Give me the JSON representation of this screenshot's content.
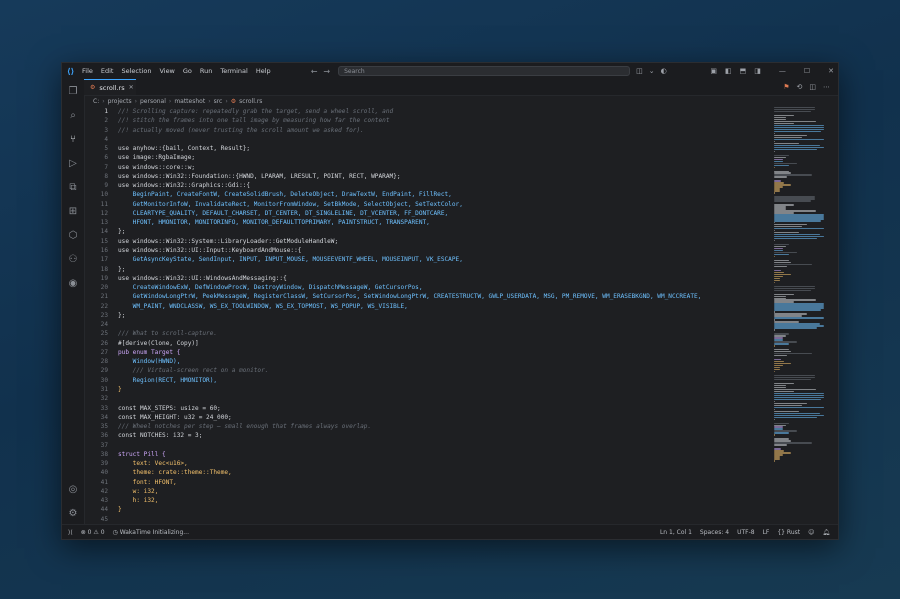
{
  "menu": [
    "File",
    "Edit",
    "Selection",
    "View",
    "Go",
    "Run",
    "Terminal",
    "Help"
  ],
  "search": {
    "placeholder": "Search"
  },
  "tab": {
    "label": "scroll.rs",
    "icon": "rust-file-icon"
  },
  "breadcrumb": [
    "C:",
    "projects",
    "personal",
    "matteshot",
    "src",
    "scroll.rs"
  ],
  "code": [
    {
      "n": "1",
      "t": "//! Scrolling capture: repeatedly grab the target, send a wheel scroll, and",
      "k": "com"
    },
    {
      "n": "2",
      "t": "//! stitch the frames into one tall image by measuring how far the content",
      "k": "com"
    },
    {
      "n": "3",
      "t": "//! actually moved (never trusting the scroll amount we asked for).",
      "k": "com"
    },
    {
      "n": "4",
      "t": "",
      "k": "txt"
    },
    {
      "n": "5",
      "t": "use anyhow::{bail, Context, Result};",
      "k": "txt"
    },
    {
      "n": "6",
      "t": "use image::RgbaImage;",
      "k": "txt"
    },
    {
      "n": "7",
      "t": "use windows::core::w;",
      "k": "txt"
    },
    {
      "n": "8",
      "t": "use windows::Win32::Foundation::{HWND, LPARAM, LRESULT, POINT, RECT, WPARAM};",
      "k": "txt"
    },
    {
      "n": "9",
      "t": "use windows::Win32::Graphics::Gdi::{",
      "k": "txt"
    },
    {
      "n": "10",
      "t": "    BeginPaint, CreateFontW, CreateSolidBrush, DeleteObject, DrawTextW, EndPaint, FillRect,",
      "k": "id"
    },
    {
      "n": "11",
      "t": "    GetMonitorInfoW, InvalidateRect, MonitorFromWindow, SetBkMode, SelectObject, SetTextColor,",
      "k": "id"
    },
    {
      "n": "12",
      "t": "    CLEARTYPE_QUALITY, DEFAULT_CHARSET, DT_CENTER, DT_SINGLELINE, DT_VCENTER, FF_DONTCARE,",
      "k": "id"
    },
    {
      "n": "13",
      "t": "    HFONT, HMONITOR, MONITORINFO, MONITOR_DEFAULTTOPRIMARY, PAINTSTRUCT, TRANSPARENT,",
      "k": "id"
    },
    {
      "n": "14",
      "t": "};",
      "k": "txt"
    },
    {
      "n": "15",
      "t": "use windows::Win32::System::LibraryLoader::GetModuleHandleW;",
      "k": "txt"
    },
    {
      "n": "16",
      "t": "use windows::Win32::UI::Input::KeyboardAndMouse::{",
      "k": "txt"
    },
    {
      "n": "17",
      "t": "    GetAsyncKeyState, SendInput, INPUT, INPUT_MOUSE, MOUSEEVENTF_WHEEL, MOUSEINPUT, VK_ESCAPE,",
      "k": "id"
    },
    {
      "n": "18",
      "t": "};",
      "k": "txt"
    },
    {
      "n": "19",
      "t": "use windows::Win32::UI::WindowsAndMessaging::{",
      "k": "txt"
    },
    {
      "n": "20",
      "t": "    CreateWindowExW, DefWindowProcW, DestroyWindow, DispatchMessageW, GetCursorPos,",
      "k": "id"
    },
    {
      "n": "21",
      "t": "    GetWindowLongPtrW, PeekMessageW, RegisterClassW, SetCursorPos, SetWindowLongPtrW, CREATESTRUCTW, GWLP_USERDATA, MSG, PM_REMOVE, WM_ERASEBKGND, WM_NCCREATE,",
      "k": "id"
    },
    {
      "n": "22",
      "t": "    WM_PAINT, WNDCLASSW, WS_EX_TOOLWINDOW, WS_EX_TOPMOST, WS_POPUP, WS_VISIBLE,",
      "k": "id"
    },
    {
      "n": "23",
      "t": "};",
      "k": "txt"
    },
    {
      "n": "24",
      "t": "",
      "k": "txt"
    },
    {
      "n": "25",
      "t": "/// What to scroll-capture.",
      "k": "com"
    },
    {
      "n": "26",
      "t": "#[derive(Clone, Copy)]",
      "k": "txt"
    },
    {
      "n": "27",
      "t": "pub enum Target {",
      "k": "kw"
    },
    {
      "n": "28",
      "t": "    Window(HWND),",
      "k": "id"
    },
    {
      "n": "29",
      "t": "    /// Virtual-screen rect on a monitor.",
      "k": "com"
    },
    {
      "n": "30",
      "t": "    Region(RECT, HMONITOR),",
      "k": "id"
    },
    {
      "n": "31",
      "t": "}",
      "k": "ty"
    },
    {
      "n": "32",
      "t": "",
      "k": "txt"
    },
    {
      "n": "33",
      "t": "const MAX_STEPS: usize = 60;",
      "k": "txt"
    },
    {
      "n": "34",
      "t": "const MAX_HEIGHT: u32 = 24_000;",
      "k": "txt"
    },
    {
      "n": "35",
      "t": "/// Wheel notches per step — small enough that frames always overlap.",
      "k": "com"
    },
    {
      "n": "36",
      "t": "const NOTCHES: i32 = 3;",
      "k": "txt"
    },
    {
      "n": "37",
      "t": "",
      "k": "txt"
    },
    {
      "n": "38",
      "t": "struct Pill {",
      "k": "kw"
    },
    {
      "n": "39",
      "t": "    text: Vec<u16>,",
      "k": "ty"
    },
    {
      "n": "40",
      "t": "    theme: crate::theme::Theme,",
      "k": "ty"
    },
    {
      "n": "41",
      "t": "    font: HFONT,",
      "k": "ty"
    },
    {
      "n": "42",
      "t": "    w: i32,",
      "k": "ty"
    },
    {
      "n": "43",
      "t": "    h: i32,",
      "k": "ty"
    },
    {
      "n": "44",
      "t": "}",
      "k": "ty"
    },
    {
      "n": "45",
      "t": "",
      "k": "txt"
    }
  ],
  "status": {
    "errors": "0",
    "warnings": "0",
    "wakatime": "WakaTime Initializing...",
    "position": "Ln 1, Col 1",
    "spaces": "Spaces: 4",
    "encoding": "UTF-8",
    "eol": "LF",
    "language": "Rust"
  }
}
